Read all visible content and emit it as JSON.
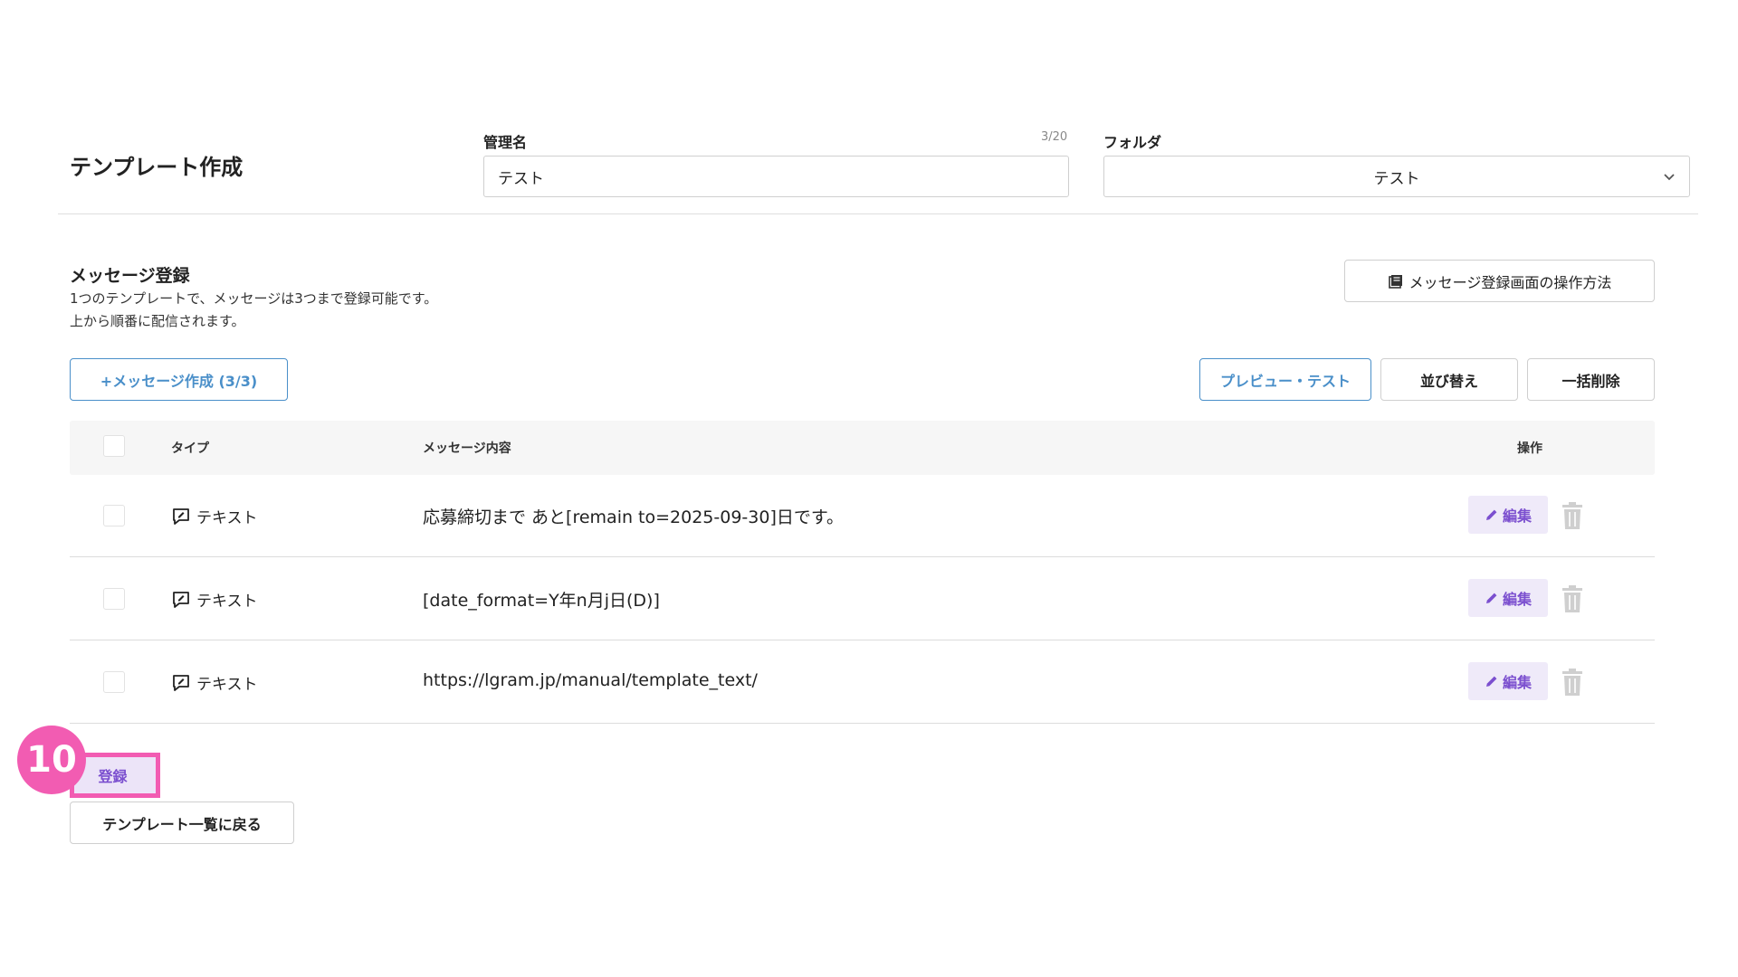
{
  "header": {
    "page_title": "テンプレート作成",
    "name_label": "管理名",
    "name_counter": "3/20",
    "name_value": "テスト",
    "folder_label": "フォルダ",
    "folder_value": "テスト"
  },
  "section": {
    "title": "メッセージ登録",
    "desc_line1": "1つのテンプレートで、メッセージは3つまで登録可能です。",
    "desc_line2": "上から順番に配信されます。",
    "help_button": "メッセージ登録画面の操作方法"
  },
  "toolbar": {
    "create_button": "+メッセージ作成 (3/3)",
    "preview_button": "プレビュー・テスト",
    "sort_button": "並び替え",
    "bulk_delete_button": "一括削除"
  },
  "table": {
    "headers": {
      "type": "タイプ",
      "content": "メッセージ内容",
      "actions": "操作"
    },
    "rows": [
      {
        "type": "テキスト",
        "content": "応募締切まで あと[remain to=2025-09-30]日です。",
        "edit": "編集"
      },
      {
        "type": "テキスト",
        "content": "[date_format=Y年n月j日(D)]",
        "edit": "編集"
      },
      {
        "type": "テキスト",
        "content": "https://lgram.jp/manual/template_text/",
        "edit": "編集"
      }
    ]
  },
  "footer": {
    "step_number": "10",
    "register_button": "登録",
    "back_button": "テンプレート一覧に戻る"
  },
  "colors": {
    "accent_blue": "#4a8fc9",
    "accent_purple": "#7b4fcf",
    "highlight_pink": "#f25cb2"
  }
}
